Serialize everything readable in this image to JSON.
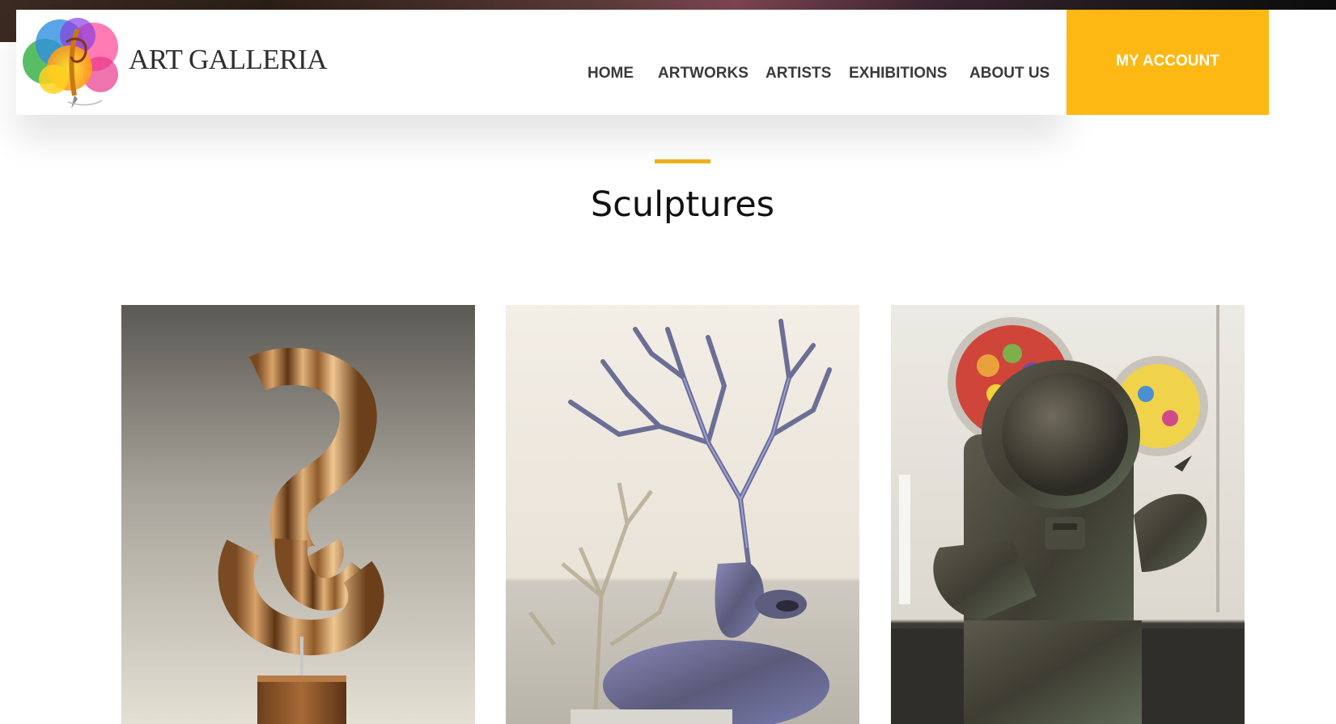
{
  "brand": {
    "name": "ART GALLERIA",
    "logo_icon": "palette-splash-logo"
  },
  "nav": {
    "items": [
      {
        "label": "HOME"
      },
      {
        "label": "ARTWORKS"
      },
      {
        "label": "ARTISTS"
      },
      {
        "label": "EXHIBITIONS"
      },
      {
        "label": "ABOUT US"
      }
    ],
    "account_label": "MY ACCOUNT"
  },
  "colors": {
    "accent": "#fdb813",
    "heading": "#111111",
    "nav_text": "#3a3a3a"
  },
  "section": {
    "title": "Sculptures"
  },
  "gallery": {
    "items": [
      {
        "subject": "wooden ribbon sculpture"
      },
      {
        "subject": "tree-antlered creature sculpture"
      },
      {
        "subject": "bronze astronaut sculpture"
      }
    ]
  }
}
